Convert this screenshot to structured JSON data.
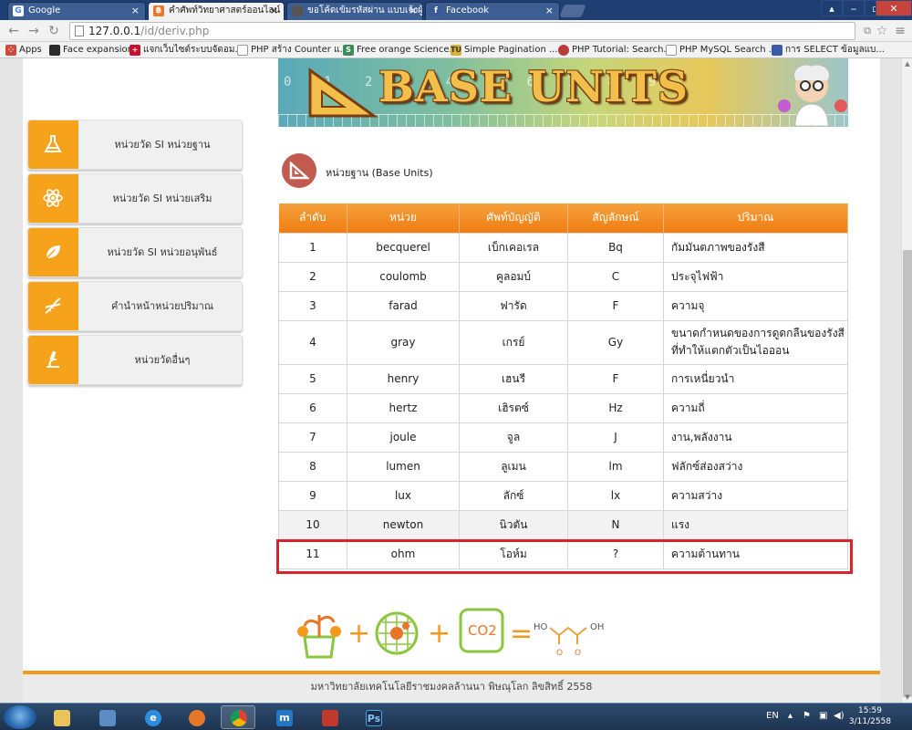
{
  "browser": {
    "tabs": [
      {
        "title": "Google",
        "active": false
      },
      {
        "title": "คำศัพท์วิทยาศาสตร์ออนไลน์",
        "active": true
      },
      {
        "title": "ขอโค้ดเข้มรหัสผ่าน แบบเจ้งผู้ใช้",
        "active": false
      },
      {
        "title": "Facebook",
        "active": false
      }
    ],
    "close_glyph": "×",
    "url_host": "127.0.0.1",
    "url_path": "/id/deriv.php",
    "bookmarks": [
      "Apps",
      "Face expansion",
      "แจกเว็บไซต์ระบบจัดอม...",
      "PHP สร้าง Counter แ...",
      "Free orange Science...",
      "Simple Pagination ...",
      "PHP Tutorial: Search...",
      "PHP MySQL Search ...",
      "การ SELECT ข้อมูลแบ..."
    ]
  },
  "sidebar": {
    "items": [
      {
        "label": "หน่วยวัด SI หน่วยฐาน",
        "icon": "flask-icon"
      },
      {
        "label": "หน่วยวัด SI หน่วยเสริม",
        "icon": "atom-icon"
      },
      {
        "label": "หน่วยวัด SI หน่วยอนุพันธ์",
        "icon": "leaf-icon"
      },
      {
        "label": "คำนำหน้าหน่วยปริมาณ",
        "icon": "dna-icon"
      },
      {
        "label": "หน่วยวัดอื่นๆ",
        "icon": "microscope-icon"
      }
    ]
  },
  "banner": {
    "title": "BASE UNITS",
    "scale_numbers": "0123456789"
  },
  "section": {
    "title": "หน่วยฐาน (Base Units)"
  },
  "table": {
    "headers": [
      "ลำดับ",
      "หน่วย",
      "ศัพท์บัญญัติ",
      "สัญลักษณ์",
      "ปริมาณ"
    ],
    "rows": [
      [
        "1",
        "becquerel",
        "เบ็กเคอเรล",
        "Bq",
        "กัมมันตภาพของรังสี"
      ],
      [
        "2",
        "coulomb",
        "คูลอมบ์",
        "C",
        "ประจุไฟฟ้า"
      ],
      [
        "3",
        "farad",
        "ฟารัด",
        "F",
        "ความจุ"
      ],
      [
        "4",
        "gray",
        "เกรย์",
        "Gy",
        "ขนาดกำหนดของการดูดกลืนของรังสีที่ทำให้แตกตัวเป็นไอออน"
      ],
      [
        "5",
        "henry",
        "เฮนรี",
        "F",
        "การเหนี่ยวนำ"
      ],
      [
        "6",
        "hertz",
        "เฮิรตซ์",
        "Hz",
        "ความถี่"
      ],
      [
        "7",
        "joule",
        "จูล",
        "J",
        "งาน,พลังงาน"
      ],
      [
        "8",
        "lumen",
        "ลูเมน",
        "lm",
        "ฟลักซ์ส่องสว่าง"
      ],
      [
        "9",
        "lux",
        "ลักซ์",
        "lx",
        "ความสว่าง"
      ],
      [
        "10",
        "newton",
        "นิวตัน",
        "N",
        "แรง"
      ],
      [
        "11",
        "ohm",
        "โอห์ม",
        "?",
        "ความต้านทาน"
      ]
    ],
    "highlight_color": "#d8232a",
    "header_color": "#f38a1c"
  },
  "equation": {
    "co2": "CO2",
    "ho": "HO",
    "oh": "OH",
    "o1": "O",
    "o2": "O"
  },
  "footer": {
    "text": "มหาวิทยาลัยเทคโนโลยีราชมงคลล้านนา พิษณุโลก ลิขสิทธิ์ 2558"
  },
  "taskbar": {
    "lang": "EN",
    "time": "15:59",
    "date": "3/11/2558"
  }
}
